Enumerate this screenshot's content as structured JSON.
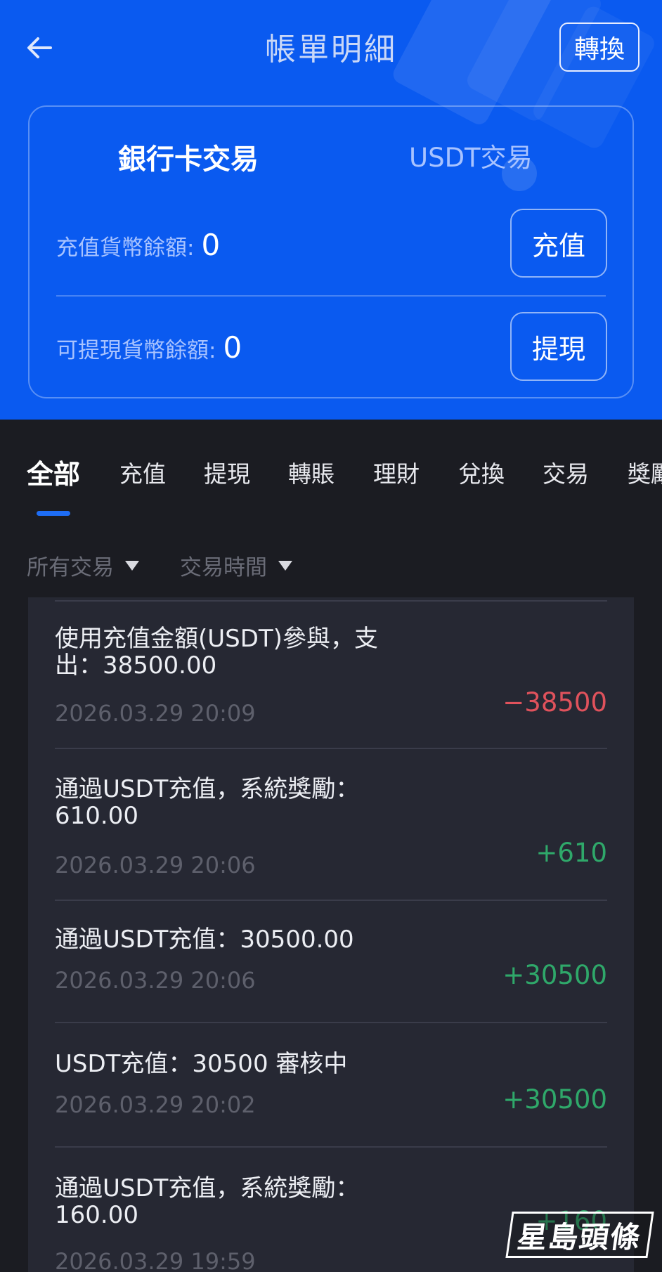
{
  "header": {
    "title": "帳單明細",
    "convert_label": "轉換",
    "accent": "#0a5af0"
  },
  "card": {
    "tabs": [
      {
        "label": "銀行卡交易",
        "active": true
      },
      {
        "label": "USDT交易",
        "active": false
      }
    ],
    "deposit_balance_label": "充值貨幣餘額:",
    "deposit_balance_value": "0",
    "deposit_button": "充值",
    "withdraw_balance_label": "可提現貨幣餘額:",
    "withdraw_balance_value": "0",
    "withdraw_button": "提現"
  },
  "tabs": [
    {
      "label": "全部",
      "active": true
    },
    {
      "label": "充值"
    },
    {
      "label": "提現"
    },
    {
      "label": "轉賬"
    },
    {
      "label": "理財"
    },
    {
      "label": "兌換"
    },
    {
      "label": "交易"
    },
    {
      "label": "獎勵"
    }
  ],
  "filters": {
    "type": "所有交易",
    "time": "交易時間"
  },
  "transactions": [
    {
      "desc": "使用充值金額(USDT)參與，支出：38500.00",
      "time": "2026.03.29 20:09",
      "amount": "−38500",
      "sign": "negative"
    },
    {
      "desc": "通過USDT充值，系統獎勵：610.00",
      "time": "2026.03.29 20:06",
      "amount": "+610",
      "sign": "positive"
    },
    {
      "desc": "通過USDT充值：30500.00",
      "time": "2026.03.29 20:06",
      "amount": "+30500",
      "sign": "positive"
    },
    {
      "desc": "USDT充值：30500 審核中",
      "time": "2026.03.29 20:02",
      "amount": "+30500",
      "sign": "positive"
    },
    {
      "desc": "通過USDT充值，系統獎勵：160.00",
      "time": "2026.03.29 19:59",
      "amount": "+160",
      "sign": "positive"
    }
  ],
  "watermark": "星島頭條",
  "colors": {
    "negative": "#e0525c",
    "positive": "#2fa86a",
    "tab_indicator": "#1e6df5"
  }
}
